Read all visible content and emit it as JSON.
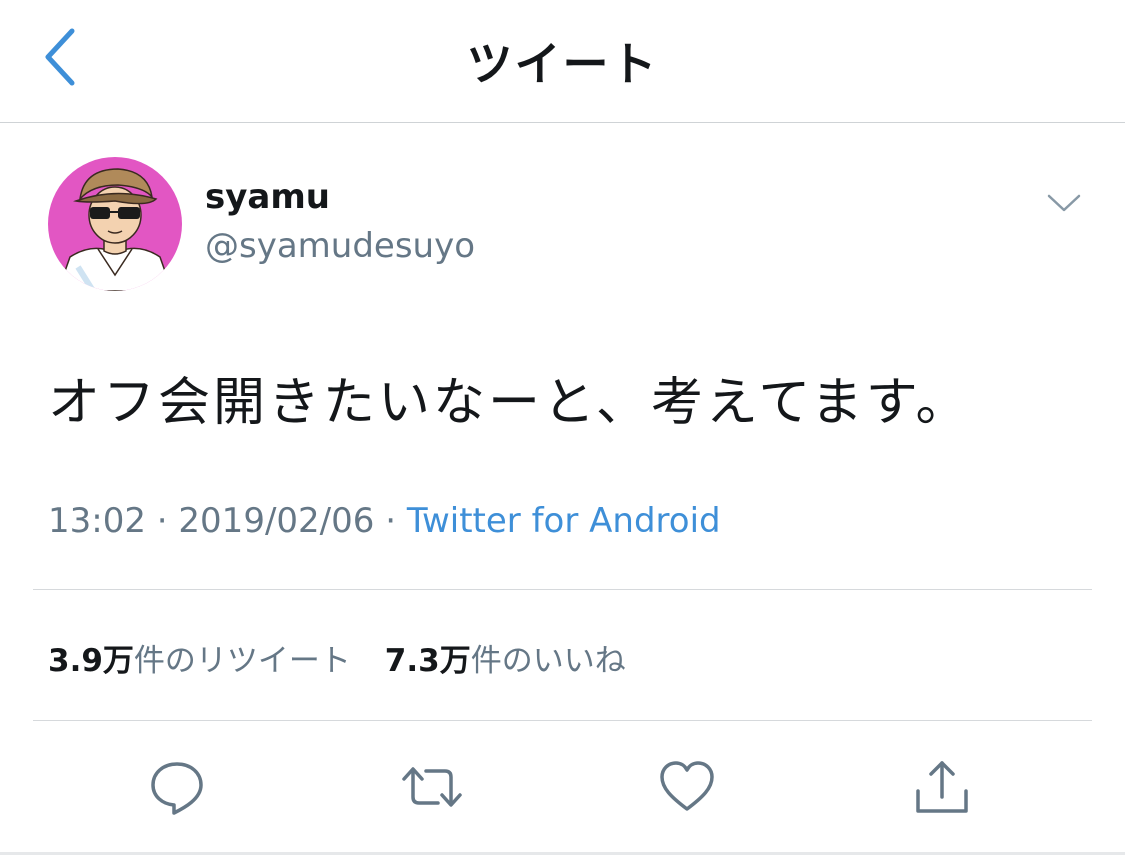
{
  "header": {
    "title": "ツイート",
    "back_icon": "chevron-left-icon",
    "accent_color": "#3e8fd8"
  },
  "tweet": {
    "author": {
      "display_name": "syamu",
      "handle": "@syamudesuyo",
      "avatar_background": "#e256c3"
    },
    "text": "オフ会開きたいなーと、考えてます。",
    "time": "13:02",
    "separator": "·",
    "date": "2019/02/06",
    "source": "Twitter for Android"
  },
  "stats": {
    "retweets": {
      "count": "3.9万",
      "label": "件のリツイート"
    },
    "likes": {
      "count": "7.3万",
      "label": "件のいいね"
    }
  },
  "actions": [
    {
      "name": "reply",
      "icon": "reply-icon"
    },
    {
      "name": "retweet",
      "icon": "retweet-icon"
    },
    {
      "name": "like",
      "icon": "heart-icon"
    },
    {
      "name": "share",
      "icon": "share-icon"
    }
  ],
  "colors": {
    "text_primary": "#14171a",
    "text_secondary": "#657786",
    "link": "#3e8fd8",
    "icon": "#657786"
  }
}
